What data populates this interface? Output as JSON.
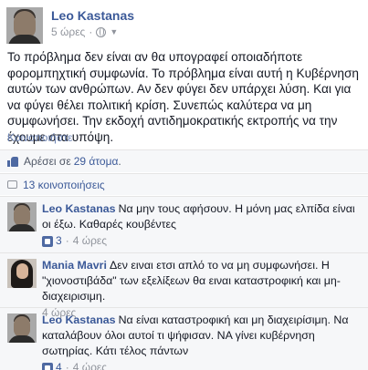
{
  "post": {
    "author": "Leo Kastanas",
    "time": "5 ώρες",
    "text": "Το πρόβλημα δεν είναι αν θα υπογραφεί οποιαδήποτε φορομπηχτική συμφωνία. Το πρόβλημα είναι αυτή η Κυβέρνηση αυτών των ανθρώπων. Αν δεν φύγει δεν υπάρχει λύση. Και για να φύγει θέλει πολιτική κρίση. Συνεπώς καλύτερα να μη συμφωνήσει. Την εκδοχή αντιδημοκρατικής εκτροπής να την έχουμε στα υπόψη.",
    "share_label": "Κοινοποιήστε",
    "icons": {
      "privacy": "globe-icon",
      "audience_menu": "chevron-down-icon"
    }
  },
  "likes": {
    "prefix": "Αρέσει σε",
    "link": "29 άτομα",
    "suffix": ".",
    "icon": "thumbs-up-icon"
  },
  "comments_count": {
    "label": "13 κοινοποιήσεις",
    "icon": "comment-bubble-icon"
  },
  "comments": [
    {
      "author": "Leo Kastanas",
      "text": "Να μην τους αφήσουν. Η μόνη μας ελπίδα είναι οι έξω. Καθαρές κουβέντες",
      "likes": "3",
      "time": "4 ώρες"
    },
    {
      "author": "Mania Mavri",
      "text": "Δεν ειναι ετσι απλό το να μη συμφωνήσει. Η \"χιονοστιβάδα\" των εξελίξεων θα ειναι καταστροφική και μη-διαχειρισιμη.",
      "likes": "",
      "time": "4 ώρες"
    },
    {
      "author": "Leo Kastanas",
      "text": "Να είναι καταστροφική και μη διαχειρίσιμη. Να καταλάβουν όλοι αυτοί τι ψήφισαν. ΝΑ γίνει κυβέρνηση σωτηρίας. Κάτι τέλος πάντων",
      "likes": "4",
      "time": "4 ώρες"
    }
  ],
  "colors": {
    "link_blue": "#3b5998",
    "text": "#141823",
    "meta_grey": "#90949c",
    "panel_bg": "#f6f7f9"
  }
}
